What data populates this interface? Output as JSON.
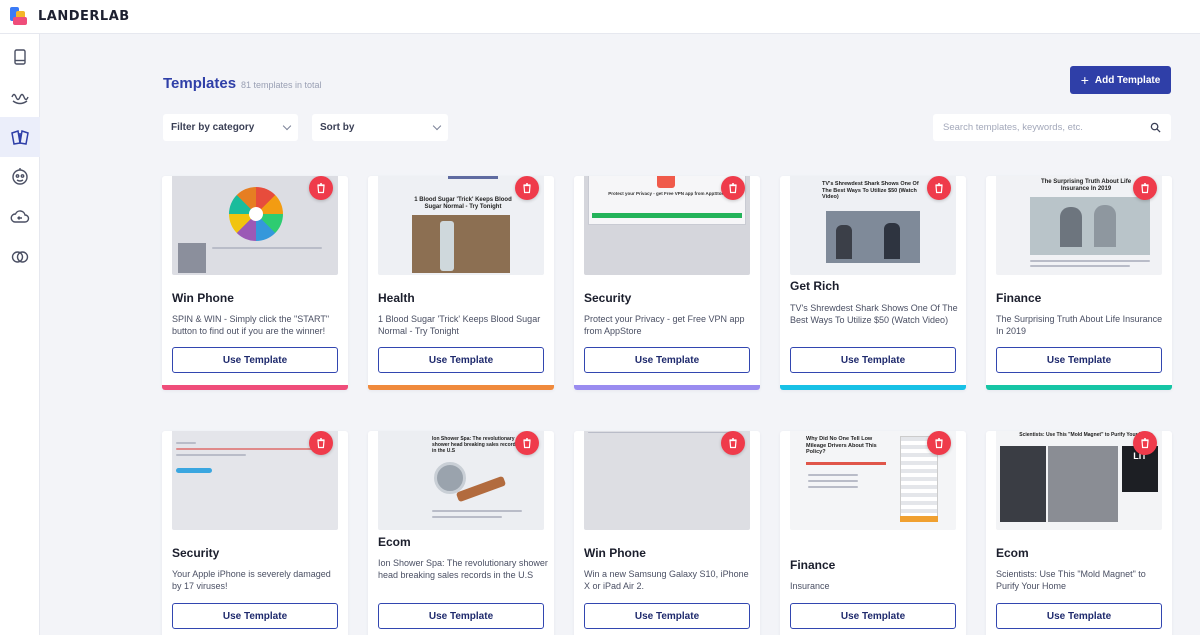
{
  "app": {
    "name": "LANDERLAB"
  },
  "sidebar": {
    "items": [
      {
        "icon": "book-icon"
      },
      {
        "icon": "wave-icon"
      },
      {
        "icon": "templates-icon",
        "active": true
      },
      {
        "icon": "alien-icon"
      },
      {
        "icon": "cloud-upload-icon"
      },
      {
        "icon": "overlap-circles-icon"
      }
    ]
  },
  "header": {
    "title": "Templates",
    "count": "81 templates in total",
    "add_label": "Add Template"
  },
  "filters": {
    "category_label": "Filter by category",
    "sort_label": "Sort by",
    "search_placeholder": "Search templates, keywords, etc."
  },
  "colors": {
    "accent": "#2f3fa8",
    "delete": "#ef3b4b",
    "stripes": [
      "#ef4d7a",
      "#f08a3c",
      "#9a8cf0",
      "#18c1e6",
      "#16c5a5"
    ]
  },
  "cards": [
    {
      "category": "Win Phone",
      "desc": "SPIN & WIN - Simply click the \"START\" button to find out if you are the winner!",
      "button": "Use Template",
      "thumb_text": ""
    },
    {
      "category": "Health",
      "desc": "1 Blood Sugar 'Trick' Keeps Blood Sugar Normal - Try Tonight",
      "button": "Use Template",
      "thumb_text": "1 Blood Sugar 'Trick' Keeps Blood Sugar Normal - Try Tonight"
    },
    {
      "category": "Security",
      "desc": "Protect your Privacy - get Free VPN app from AppStore",
      "button": "Use Template",
      "thumb_text": "Protect your Privacy - get Free VPN app from AppStore"
    },
    {
      "category": "Get Rich",
      "desc": "TV's Shrewdest Shark Shows One Of The Best Ways To Utilize $50 (Watch Video)",
      "button": "Use Template",
      "thumb_text": "TV's Shrewdest Shark Shows One Of The Best Ways To Utilize $50 (Watch Video)"
    },
    {
      "category": "Finance",
      "desc": "The Surprising Truth About Life Insurance In 2019",
      "button": "Use Template",
      "thumb_text": "The Surprising Truth About Life Insurance In 2019"
    },
    {
      "category": "Security",
      "desc": "Your Apple iPhone is severely damaged by 17 viruses!",
      "button": "Use Template",
      "thumb_text": ""
    },
    {
      "category": "Ecom",
      "desc": "Ion Shower Spa: The revolutionary shower head breaking sales records in the U.S",
      "button": "Use Template",
      "thumb_text": "Ion Shower Spa: The revolutionary shower head breaking sales records in the U.S"
    },
    {
      "category": "Win Phone",
      "desc": "Win a new Samsung Galaxy S10, iPhone X or iPad Air 2.",
      "button": "Use Template",
      "thumb_text": ""
    },
    {
      "category": "Finance",
      "desc": "Insurance",
      "button": "Use Template",
      "thumb_text": "Why Did No One Tell Low Mileage Drivers About This Policy?"
    },
    {
      "category": "Ecom",
      "desc": "Scientists: Use This \"Mold Magnet\" to Purify Your Home",
      "button": "Use Template",
      "thumb_text": "Scientists: Use This \"Mold Magnet\" to Purify Your Home"
    }
  ]
}
